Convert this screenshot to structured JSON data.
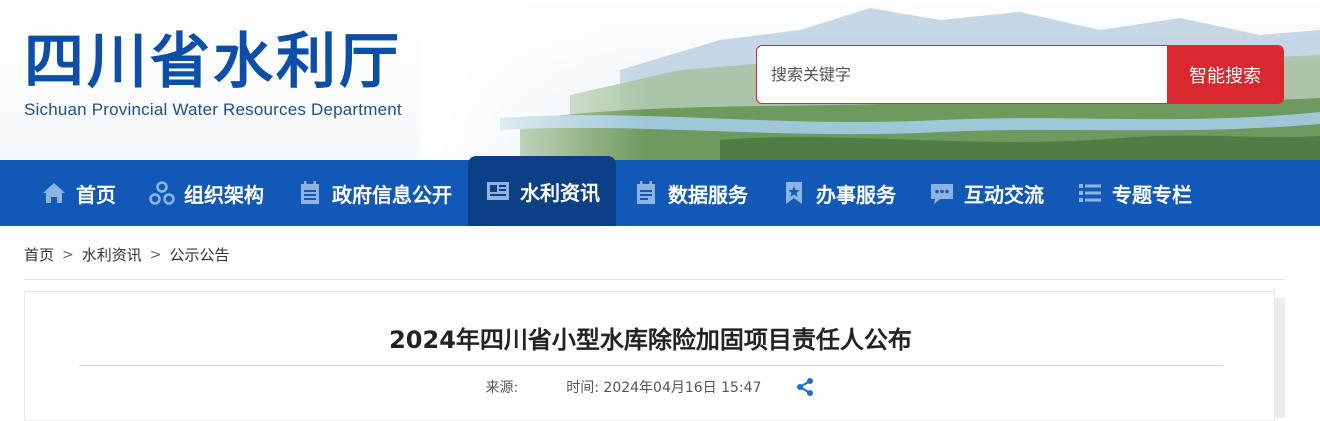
{
  "header": {
    "title_cn": "四川省水利厅",
    "title_en": "Sichuan Provincial Water Resources Department",
    "search": {
      "placeholder": "搜索关键字",
      "button_label": "智能搜索"
    }
  },
  "nav": {
    "items": [
      {
        "label": "首页",
        "icon": "home-icon"
      },
      {
        "label": "组织架构",
        "icon": "org-icon"
      },
      {
        "label": "政府信息公开",
        "icon": "document-icon"
      },
      {
        "label": "水利资讯",
        "icon": "news-icon",
        "active": true
      },
      {
        "label": "数据服务",
        "icon": "data-icon"
      },
      {
        "label": "办事服务",
        "icon": "bookmark-icon"
      },
      {
        "label": "互动交流",
        "icon": "chat-icon"
      },
      {
        "label": "专题专栏",
        "icon": "list-icon"
      }
    ]
  },
  "breadcrumb": {
    "items": [
      "首页",
      "水利资讯",
      "公示公告"
    ],
    "separator": ">"
  },
  "article": {
    "title": "2024年四川省小型水库除险加固项目责任人公布",
    "source_label": "来源:",
    "time_label": "时间:",
    "time_value": "2024年04月16日 15:47"
  },
  "colors": {
    "brand_blue": "#0d4fa8",
    "nav_blue": "#1258b6",
    "nav_active": "#0b3f86",
    "search_red": "#d9282f"
  }
}
